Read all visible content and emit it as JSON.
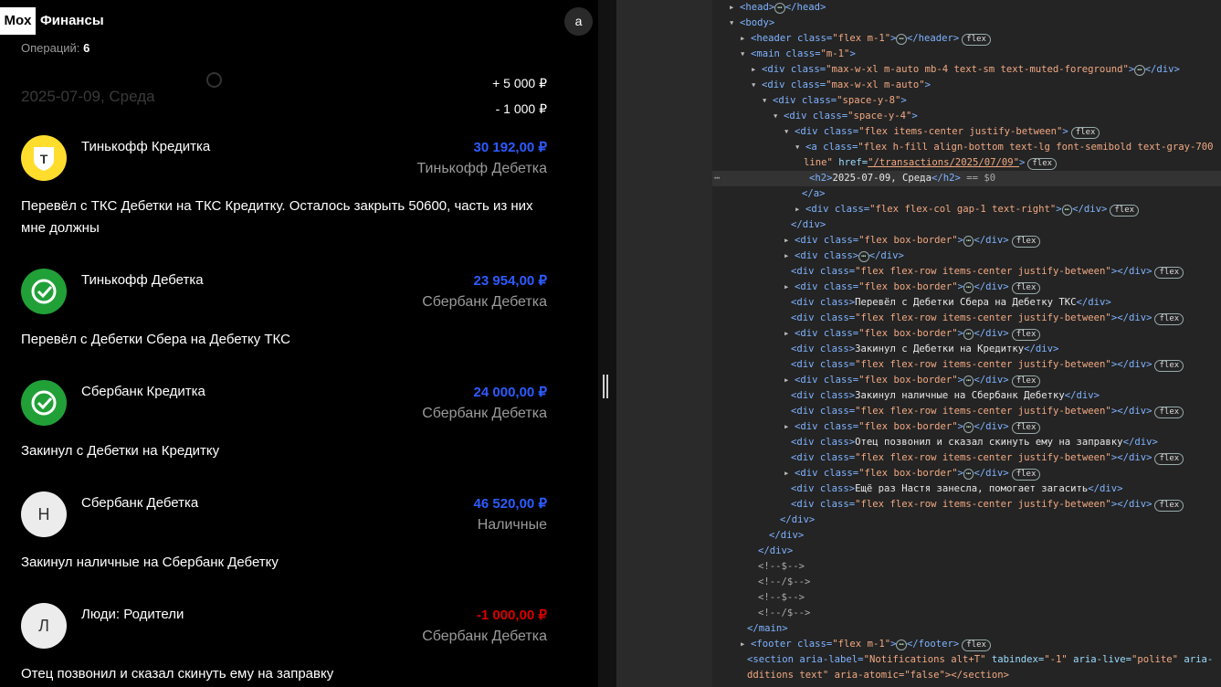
{
  "app": {
    "logo_mox": "Mox",
    "logo_name": "Финансы",
    "avatar_letter": "a",
    "operations_label": "Операций:",
    "operations_count": "6",
    "date_heading": "2025-07-09, Среда",
    "totals": [
      "+ 5 000 ₽",
      "- 1 000 ₽"
    ],
    "transactions": [
      {
        "title": "Тинькофф Кредитка",
        "amount": "30 192,00 ₽",
        "account": "Тинькофф Дебетка",
        "note": "Перевёл с ТКС Дебетки на ТКС Кредитку. Осталось закрыть 50600, часть из них мне должны",
        "icon": "tinkoff-shield-icon",
        "icon_color": "#ffdd2d"
      },
      {
        "title": "Тинькофф Дебетка",
        "amount": "23 954,00 ₽",
        "account": "Сбербанк Дебетка",
        "note": "Перевёл с Дебетки Сбера на Дебетку ТКС",
        "icon": "sber-check-icon",
        "icon_color": "#21a038"
      },
      {
        "title": "Сбербанк Кредитка",
        "amount": "24 000,00 ₽",
        "account": "Сбербанк Дебетка",
        "note": "Закинул с Дебетки на Кредитку",
        "icon": "sber-check-icon",
        "icon_color": "#21a038"
      },
      {
        "title": "Сбербанк Дебетка",
        "amount": "46 520,00 ₽",
        "account": "Наличные",
        "note": "Закинул наличные на Сбербанк Дебетку",
        "icon": "letter-avatar-icon",
        "letter": "Н"
      },
      {
        "title": "Люди: Родители",
        "amount": "-1 000,00 ₽",
        "account": "Сбербанк Дебетка",
        "note": "Отец позвонил и сказал скинуть ему на заправку",
        "icon": "letter-avatar-icon",
        "letter": "Л"
      }
    ],
    "colors": {
      "positive": "#2d5bff",
      "negative": "#d80000"
    }
  },
  "devtools": {
    "l_head_open": "<head>",
    "l_head_close": "</head>",
    "l_body": "<body>",
    "l_header_a": "<header class=",
    "l_header_v": "\"flex m-1\"",
    "l_header_c": "</header>",
    "l_main_a": "<main class=",
    "l_main_v": "\"m-1\"",
    "l_main_c": ">",
    "l_div1_a": "<div class=",
    "l_div1_v": "\"max-w-xl m-auto mb-4 text-sm text-muted-foreground\"",
    "l_div1_c": "</div>",
    "l_div2_a": "<div class=",
    "l_div2_v": "\"max-w-xl m-auto\"",
    "l_div2_c": ">",
    "l_div3_a": "<div class=",
    "l_div3_v": "\"space-y-8\"",
    "l_div3_c": ">",
    "l_div4_a": "<div class=",
    "l_div4_v": "\"space-y-4\"",
    "l_div4_c": ">",
    "l_div5_a": "<div class=",
    "l_div5_v": "\"flex items-center justify-between\"",
    "l_div5_c": ">",
    "l_a_a": "<a class=",
    "l_a_v": "\"flex h-fill align-bottom text-lg font-semibold text-gray-700",
    "l_a2_v": "line\"",
    "l_a2_b": " href=",
    "l_a2_h": "\"/transactions/2025/07/09\"",
    "l_a2_c": ">",
    "l_h2_a": "<h2>",
    "l_h2_t": "2025-07-09, Среда",
    "l_h2_c": "</h2>",
    "l_h2_eq": " == $0",
    "l_a_close": "</a>",
    "l_col_a": "<div class=",
    "l_col_v": "\"flex flex-col gap-1 text-right\"",
    "l_col_c": "</div>",
    "l_divclose": "</div>",
    "l_bb_a": "<div class=",
    "l_bb_v": "\"flex box-border\"",
    "l_bb_c": "</div>",
    "l_dc_a": "<div class>",
    "l_dc_c": "</div>",
    "l_row_a": "<div class=",
    "l_row_v": "\"flex flex-row items-center justify-between\"",
    "l_row_c": "</div>",
    "n1": "Перевёл с Дебетки Сбера на Дебетку ТКС",
    "n2": "Закинул с Дебетки на Кредитку",
    "n3": "Закинул наличные на Сбербанк Дебетку",
    "n4": "Отец позвонил и сказал скинуть ему на заправку",
    "n5": "Ещё раз Настя занесла, помогает загасить",
    "c1": "<!--$-->",
    "c2": "<!--/$-->",
    "l_main_close": "</main>",
    "l_footer_a": "<footer class=",
    "l_footer_v": "\"flex m-1\"",
    "l_footer_c": "</footer>",
    "l_section_a": "<section aria-label=",
    "l_section_v": "\"Notifications alt+T\"",
    "l_section_b": " tabindex=",
    "l_section_bv": "\"-1\"",
    "l_section_c": " aria-live=",
    "l_section_cv": "\"polite\"",
    "l_section_d": " aria-",
    "l_section2": "dditions text\" aria-atomic=\"false\"></section>",
    "badge_flex": "flex",
    "ellipsis": "⋯",
    "gutter_dots": "⋯"
  }
}
